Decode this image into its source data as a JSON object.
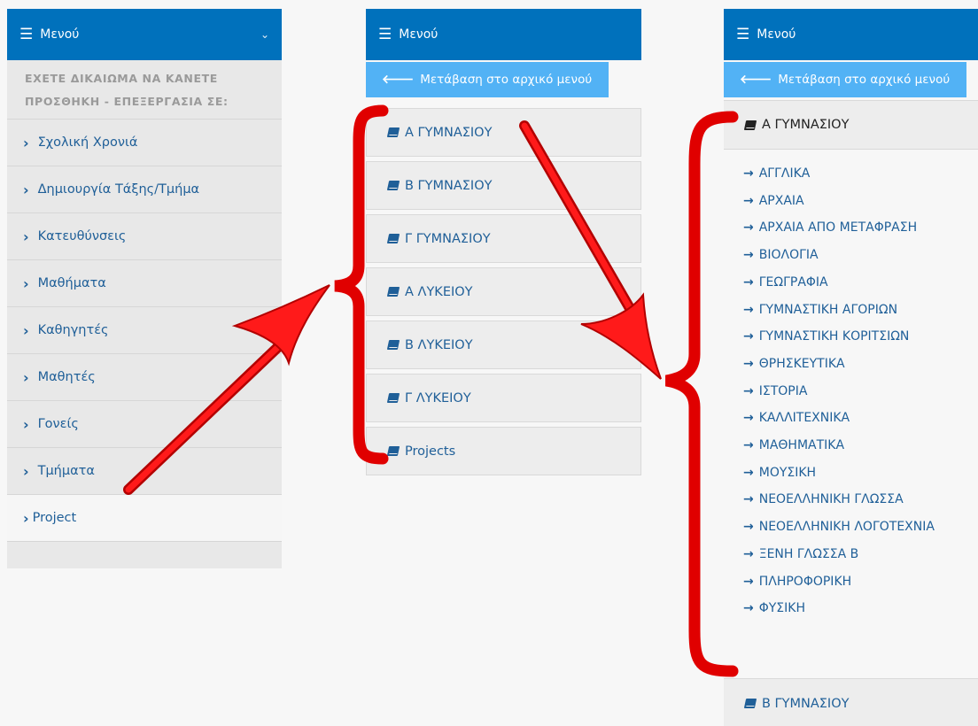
{
  "menu_title": "Μενού",
  "back_label": "Μετάβαση στο αρχικό μενού",
  "rights_text": "ΕΧΕΤΕ ΔΙΚΑΙΩΜΑ ΝΑ ΚΑΝΕΤΕ ΠΡΟΣΘΗΚΗ - ΕΠΕΞΕΡΓΑΣΙΑ ΣΕ:",
  "main_menu": [
    "Σχολική Χρονιά",
    "Δημιουργία Τάξης/Τμήμα",
    "Κατευθύνσεις",
    "Μαθήματα",
    "Καθηγητές",
    "Μαθητές",
    "Γονείς",
    "Τμήματα",
    "Project"
  ],
  "classes": [
    "Α ΓΥΜΝΑΣΙΟΥ",
    "Β ΓΥΜΝΑΣΙΟΥ",
    "Γ ΓΥΜΝΑΣΙΟΥ",
    "Α ΛΥΚΕΙΟΥ",
    "Β ΛΥΚΕΙΟΥ",
    "Γ ΛΥΚΕΙΟΥ",
    "Projects"
  ],
  "selected_class": "Α ΓΥΜΝΑΣΙΟΥ",
  "subjects": [
    "ΑΓΓΛΙΚΑ",
    "ΑΡΧΑΙΑ",
    "ΑΡΧΑΙΑ ΑΠΟ ΜΕΤΑΦΡΑΣΗ",
    "ΒΙΟΛΟΓΙΑ",
    "ΓΕΩΓΡΑΦΙΑ",
    "ΓΥΜΝΑΣΤΙΚΗ ΑΓΟΡΙΩΝ",
    "ΓΥΜΝΑΣΤΙΚΗ ΚΟΡΙΤΣΙΩΝ",
    "ΘΡΗΣΚΕΥΤΙΚΑ",
    "ΙΣΤΟΡΙΑ",
    "ΚΑΛΛΙΤΕΧΝΙΚΑ",
    "ΜΑΘΗΜΑΤΙΚΑ",
    "ΜΟΥΣΙΚΗ",
    "ΝΕΟΕΛΛΗΝΙΚΗ ΓΛΩΣΣΑ",
    "ΝΕΟΕΛΛΗΝΙΚΗ ΛΟΓΟΤΕΧΝΙΑ",
    "ΞΕΝΗ ΓΛΩΣΣΑ Β",
    "ΠΛΗΡΟΦΟΡΙΚΗ",
    "ΦΥΣΙΚΗ"
  ],
  "next_class": "Β ΓΥΜΝΑΣΙΟΥ",
  "colors": {
    "header": "#0071bc",
    "back_button": "#52b2f5",
    "link": "#1f5f98",
    "annotation": "#e00000"
  }
}
